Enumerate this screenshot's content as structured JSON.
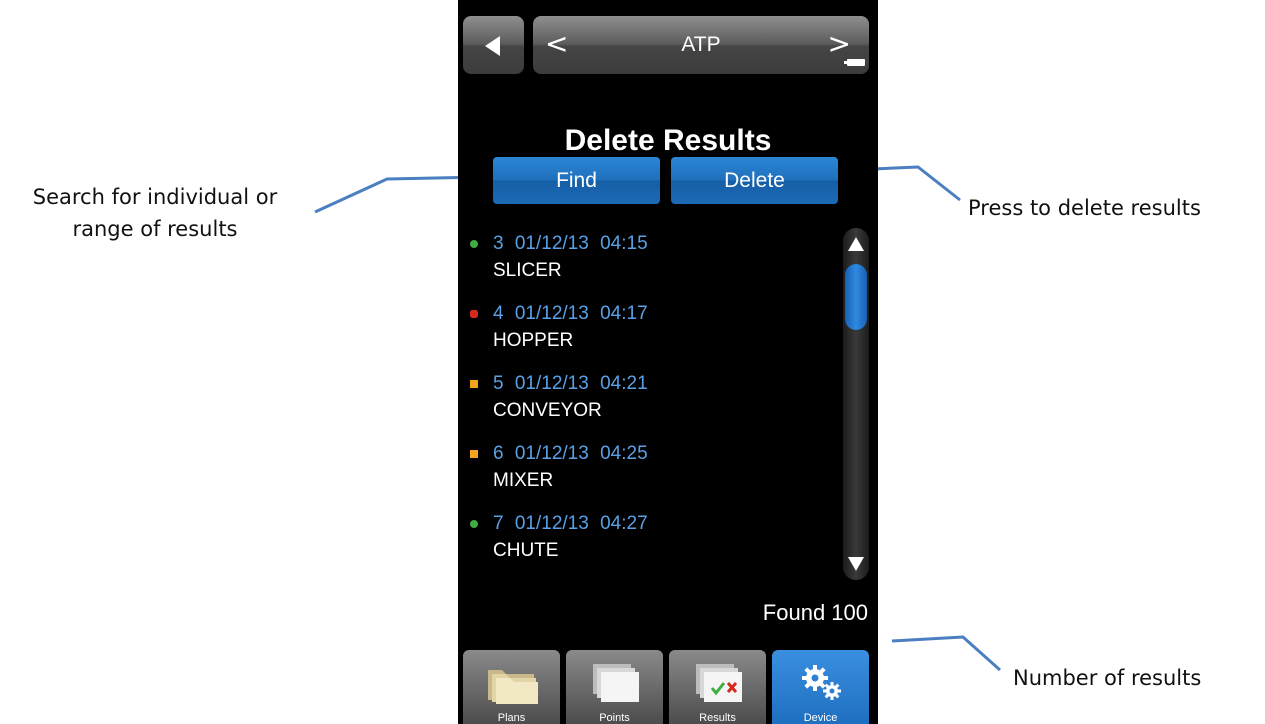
{
  "annotations": {
    "find_note_line1": "Search for individual or",
    "find_note_line2": "range of results",
    "delete_note": "Press to delete results",
    "count_note": "Number of results"
  },
  "header": {
    "nav_title": "ATP",
    "prev_label": "<",
    "next_label": ">"
  },
  "page_title": "Delete Results",
  "actions": {
    "find_label": "Find",
    "delete_label": "Delete"
  },
  "results": [
    {
      "id": "3",
      "date": "01/12/13",
      "time": "04:15",
      "name": "SLICER",
      "status": "pass",
      "color": "#3fae3f",
      "shape": "circle"
    },
    {
      "id": "4",
      "date": "01/12/13",
      "time": "04:17",
      "name": "HOPPER",
      "status": "fail",
      "color": "#d42a1e",
      "shape": "octagon"
    },
    {
      "id": "5",
      "date": "01/12/13",
      "time": "04:21",
      "name": "CONVEYOR",
      "status": "caution",
      "color": "#f2a51a",
      "shape": "square"
    },
    {
      "id": "6",
      "date": "01/12/13",
      "time": "04:25",
      "name": "MIXER",
      "status": "caution",
      "color": "#f2a51a",
      "shape": "square"
    },
    {
      "id": "7",
      "date": "01/12/13",
      "time": "04:27",
      "name": "CHUTE",
      "status": "pass",
      "color": "#3fae3f",
      "shape": "circle"
    }
  ],
  "found_text": "Found 100",
  "tabs": [
    {
      "label": "Plans",
      "icon": "folder-icon"
    },
    {
      "label": "Points",
      "icon": "pages-icon"
    },
    {
      "label": "Results",
      "icon": "results-check-icon"
    },
    {
      "label": "Device",
      "icon": "gears-icon",
      "active": true
    }
  ],
  "colors": {
    "accent": "#1f6fbb",
    "meta_text": "#5aa0e6",
    "background": "#000000",
    "callout_line": "#4a7fc1"
  }
}
